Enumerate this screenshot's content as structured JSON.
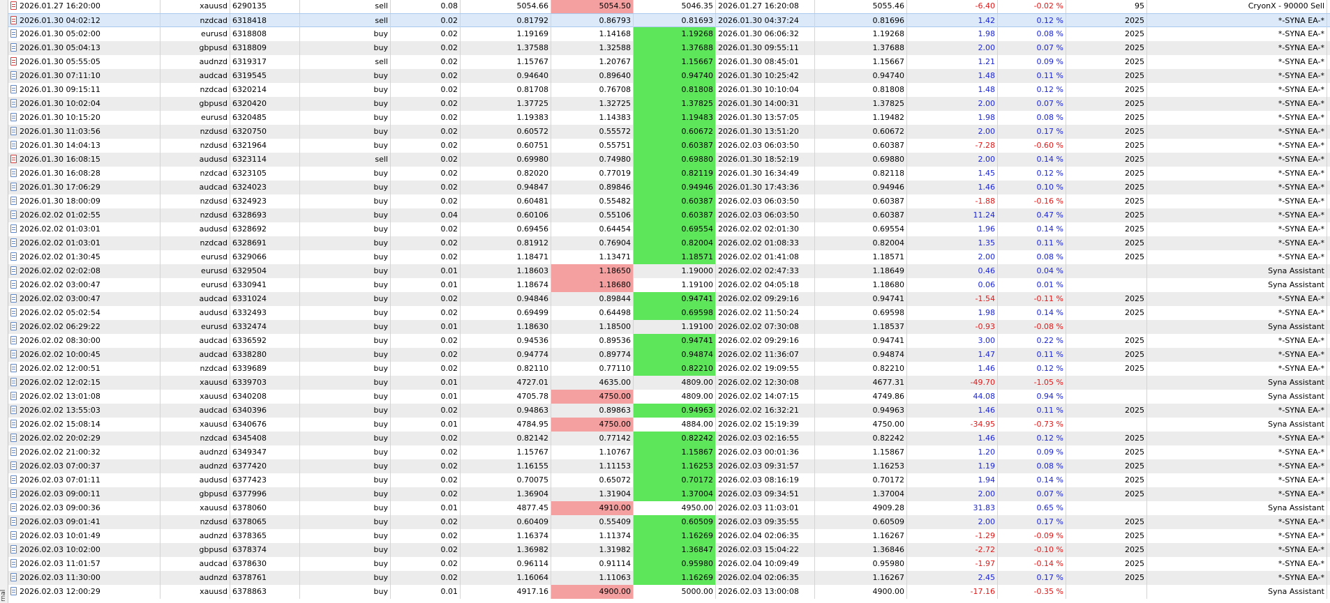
{
  "colors": {
    "sl_hit": "#f4a0a0",
    "tp_hit": "#5ee65a",
    "profit_positive": "#1a24d6",
    "profit_negative": "#e01818",
    "selected_row": "#dbe9f9"
  },
  "panel": {
    "side_label": "rnal"
  },
  "rows": [
    {
      "time": "2026.01.27 16:20:00",
      "symbol": "xauusd",
      "ticket": "6290135",
      "type": "sell",
      "volume": "0.08",
      "price": "5054.66",
      "sl": "5054.50",
      "tp": "5046.35",
      "close_time": "2026.01.27 16:20:08",
      "close_price": "5055.46",
      "profit": "-6.40",
      "change": "-0.02 %",
      "magic": "95",
      "comment": "CryonX - 90000 Sell",
      "sl_hit": true,
      "tp_hit": false
    },
    {
      "time": "2026.01.30 04:02:12",
      "symbol": "nzdcad",
      "ticket": "6318418",
      "type": "sell",
      "volume": "0.02",
      "price": "0.81792",
      "sl": "0.86793",
      "tp": "0.81693",
      "close_time": "2026.01.30 04:37:24",
      "close_price": "0.81696",
      "profit": "1.42",
      "change": "0.12 %",
      "magic": "2025",
      "comment": "*-SYNA EA-*",
      "sl_hit": false,
      "tp_hit": false,
      "selected": true
    },
    {
      "time": "2026.01.30 05:02:00",
      "symbol": "eurusd",
      "ticket": "6318808",
      "type": "buy",
      "volume": "0.02",
      "price": "1.19169",
      "sl": "1.14168",
      "tp": "1.19268",
      "close_time": "2026.01.30 06:06:32",
      "close_price": "1.19268",
      "profit": "1.98",
      "change": "0.08 %",
      "magic": "2025",
      "comment": "*-SYNA EA-*",
      "sl_hit": false,
      "tp_hit": true
    },
    {
      "time": "2026.01.30 05:04:13",
      "symbol": "gbpusd",
      "ticket": "6318809",
      "type": "buy",
      "volume": "0.02",
      "price": "1.37588",
      "sl": "1.32588",
      "tp": "1.37688",
      "close_time": "2026.01.30 09:55:11",
      "close_price": "1.37688",
      "profit": "2.00",
      "change": "0.07 %",
      "magic": "2025",
      "comment": "*-SYNA EA-*",
      "sl_hit": false,
      "tp_hit": true
    },
    {
      "time": "2026.01.30 05:55:05",
      "symbol": "audnzd",
      "ticket": "6319317",
      "type": "sell",
      "volume": "0.02",
      "price": "1.15767",
      "sl": "1.20767",
      "tp": "1.15667",
      "close_time": "2026.01.30 08:45:01",
      "close_price": "1.15667",
      "profit": "1.21",
      "change": "0.09 %",
      "magic": "2025",
      "comment": "*-SYNA EA-*",
      "sl_hit": false,
      "tp_hit": true
    },
    {
      "time": "2026.01.30 07:11:10",
      "symbol": "audcad",
      "ticket": "6319545",
      "type": "buy",
      "volume": "0.02",
      "price": "0.94640",
      "sl": "0.89640",
      "tp": "0.94740",
      "close_time": "2026.01.30 10:25:42",
      "close_price": "0.94740",
      "profit": "1.48",
      "change": "0.11 %",
      "magic": "2025",
      "comment": "*-SYNA EA-*",
      "sl_hit": false,
      "tp_hit": true
    },
    {
      "time": "2026.01.30 09:15:11",
      "symbol": "nzdcad",
      "ticket": "6320214",
      "type": "buy",
      "volume": "0.02",
      "price": "0.81708",
      "sl": "0.76708",
      "tp": "0.81808",
      "close_time": "2026.01.30 10:10:04",
      "close_price": "0.81808",
      "profit": "1.48",
      "change": "0.12 %",
      "magic": "2025",
      "comment": "*-SYNA EA-*",
      "sl_hit": false,
      "tp_hit": true
    },
    {
      "time": "2026.01.30 10:02:04",
      "symbol": "gbpusd",
      "ticket": "6320420",
      "type": "buy",
      "volume": "0.02",
      "price": "1.37725",
      "sl": "1.32725",
      "tp": "1.37825",
      "close_time": "2026.01.30 14:00:31",
      "close_price": "1.37825",
      "profit": "2.00",
      "change": "0.07 %",
      "magic": "2025",
      "comment": "*-SYNA EA-*",
      "sl_hit": false,
      "tp_hit": true
    },
    {
      "time": "2026.01.30 10:15:20",
      "symbol": "eurusd",
      "ticket": "6320485",
      "type": "buy",
      "volume": "0.02",
      "price": "1.19383",
      "sl": "1.14383",
      "tp": "1.19483",
      "close_time": "2026.01.30 13:57:05",
      "close_price": "1.19482",
      "profit": "1.98",
      "change": "0.08 %",
      "magic": "2025",
      "comment": "*-SYNA EA-*",
      "sl_hit": false,
      "tp_hit": true
    },
    {
      "time": "2026.01.30 11:03:56",
      "symbol": "nzdusd",
      "ticket": "6320750",
      "type": "buy",
      "volume": "0.02",
      "price": "0.60572",
      "sl": "0.55572",
      "tp": "0.60672",
      "close_time": "2026.01.30 13:51:20",
      "close_price": "0.60672",
      "profit": "2.00",
      "change": "0.17 %",
      "magic": "2025",
      "comment": "*-SYNA EA-*",
      "sl_hit": false,
      "tp_hit": true
    },
    {
      "time": "2026.01.30 14:04:13",
      "symbol": "nzdusd",
      "ticket": "6321964",
      "type": "buy",
      "volume": "0.02",
      "price": "0.60751",
      "sl": "0.55751",
      "tp": "0.60387",
      "close_time": "2026.02.03 06:03:50",
      "close_price": "0.60387",
      "profit": "-7.28",
      "change": "-0.60 %",
      "magic": "2025",
      "comment": "*-SYNA EA-*",
      "sl_hit": false,
      "tp_hit": true
    },
    {
      "time": "2026.01.30 16:08:15",
      "symbol": "audusd",
      "ticket": "6323114",
      "type": "sell",
      "volume": "0.02",
      "price": "0.69980",
      "sl": "0.74980",
      "tp": "0.69880",
      "close_time": "2026.01.30 18:52:19",
      "close_price": "0.69880",
      "profit": "2.00",
      "change": "0.14 %",
      "magic": "2025",
      "comment": "*-SYNA EA-*",
      "sl_hit": false,
      "tp_hit": true
    },
    {
      "time": "2026.01.30 16:08:28",
      "symbol": "nzdcad",
      "ticket": "6323105",
      "type": "buy",
      "volume": "0.02",
      "price": "0.82020",
      "sl": "0.77019",
      "tp": "0.82119",
      "close_time": "2026.01.30 16:34:49",
      "close_price": "0.82118",
      "profit": "1.45",
      "change": "0.12 %",
      "magic": "2025",
      "comment": "*-SYNA EA-*",
      "sl_hit": false,
      "tp_hit": true
    },
    {
      "time": "2026.01.30 17:06:29",
      "symbol": "audcad",
      "ticket": "6324023",
      "type": "buy",
      "volume": "0.02",
      "price": "0.94847",
      "sl": "0.89846",
      "tp": "0.94946",
      "close_time": "2026.01.30 17:43:36",
      "close_price": "0.94946",
      "profit": "1.46",
      "change": "0.10 %",
      "magic": "2025",
      "comment": "*-SYNA EA-*",
      "sl_hit": false,
      "tp_hit": true
    },
    {
      "time": "2026.01.30 18:00:09",
      "symbol": "nzdusd",
      "ticket": "6324923",
      "type": "buy",
      "volume": "0.02",
      "price": "0.60481",
      "sl": "0.55482",
      "tp": "0.60387",
      "close_time": "2026.02.03 06:03:50",
      "close_price": "0.60387",
      "profit": "-1.88",
      "change": "-0.16 %",
      "magic": "2025",
      "comment": "*-SYNA EA-*",
      "sl_hit": false,
      "tp_hit": true
    },
    {
      "time": "2026.02.02 01:02:55",
      "symbol": "nzdusd",
      "ticket": "6328693",
      "type": "buy",
      "volume": "0.04",
      "price": "0.60106",
      "sl": "0.55106",
      "tp": "0.60387",
      "close_time": "2026.02.03 06:03:50",
      "close_price": "0.60387",
      "profit": "11.24",
      "change": "0.47 %",
      "magic": "2025",
      "comment": "*-SYNA EA-*",
      "sl_hit": false,
      "tp_hit": true
    },
    {
      "time": "2026.02.02 01:03:01",
      "symbol": "audusd",
      "ticket": "6328692",
      "type": "buy",
      "volume": "0.02",
      "price": "0.69456",
      "sl": "0.64454",
      "tp": "0.69554",
      "close_time": "2026.02.02 02:01:30",
      "close_price": "0.69554",
      "profit": "1.96",
      "change": "0.14 %",
      "magic": "2025",
      "comment": "*-SYNA EA-*",
      "sl_hit": false,
      "tp_hit": true
    },
    {
      "time": "2026.02.02 01:03:01",
      "symbol": "nzdcad",
      "ticket": "6328691",
      "type": "buy",
      "volume": "0.02",
      "price": "0.81912",
      "sl": "0.76904",
      "tp": "0.82004",
      "close_time": "2026.02.02 01:08:33",
      "close_price": "0.82004",
      "profit": "1.35",
      "change": "0.11 %",
      "magic": "2025",
      "comment": "*-SYNA EA-*",
      "sl_hit": false,
      "tp_hit": true
    },
    {
      "time": "2026.02.02 01:30:45",
      "symbol": "eurusd",
      "ticket": "6329066",
      "type": "buy",
      "volume": "0.02",
      "price": "1.18471",
      "sl": "1.13471",
      "tp": "1.18571",
      "close_time": "2026.02.02 01:41:08",
      "close_price": "1.18571",
      "profit": "2.00",
      "change": "0.08 %",
      "magic": "2025",
      "comment": "*-SYNA EA-*",
      "sl_hit": false,
      "tp_hit": true
    },
    {
      "time": "2026.02.02 02:02:08",
      "symbol": "eurusd",
      "ticket": "6329504",
      "type": "buy",
      "volume": "0.01",
      "price": "1.18603",
      "sl": "1.18650",
      "tp": "1.19000",
      "close_time": "2026.02.02 02:47:33",
      "close_price": "1.18649",
      "profit": "0.46",
      "change": "0.04 %",
      "magic": "",
      "comment": "Syna Assistant",
      "sl_hit": true,
      "tp_hit": false
    },
    {
      "time": "2026.02.02 03:00:47",
      "symbol": "eurusd",
      "ticket": "6330941",
      "type": "buy",
      "volume": "0.01",
      "price": "1.18674",
      "sl": "1.18680",
      "tp": "1.19100",
      "close_time": "2026.02.02 04:05:18",
      "close_price": "1.18680",
      "profit": "0.06",
      "change": "0.01 %",
      "magic": "",
      "comment": "Syna Assistant",
      "sl_hit": true,
      "tp_hit": false
    },
    {
      "time": "2026.02.02 03:00:47",
      "symbol": "audcad",
      "ticket": "6331024",
      "type": "buy",
      "volume": "0.02",
      "price": "0.94846",
      "sl": "0.89844",
      "tp": "0.94741",
      "close_time": "2026.02.02 09:29:16",
      "close_price": "0.94741",
      "profit": "-1.54",
      "change": "-0.11 %",
      "magic": "2025",
      "comment": "*-SYNA EA-*",
      "sl_hit": false,
      "tp_hit": true
    },
    {
      "time": "2026.02.02 05:02:54",
      "symbol": "audusd",
      "ticket": "6332493",
      "type": "buy",
      "volume": "0.02",
      "price": "0.69499",
      "sl": "0.64498",
      "tp": "0.69598",
      "close_time": "2026.02.02 11:50:24",
      "close_price": "0.69598",
      "profit": "1.98",
      "change": "0.14 %",
      "magic": "2025",
      "comment": "*-SYNA EA-*",
      "sl_hit": false,
      "tp_hit": true
    },
    {
      "time": "2026.02.02 06:29:22",
      "symbol": "eurusd",
      "ticket": "6332474",
      "type": "buy",
      "volume": "0.01",
      "price": "1.18630",
      "sl": "1.18500",
      "tp": "1.19100",
      "close_time": "2026.02.02 07:30:08",
      "close_price": "1.18537",
      "profit": "-0.93",
      "change": "-0.08 %",
      "magic": "",
      "comment": "Syna Assistant",
      "sl_hit": false,
      "tp_hit": false
    },
    {
      "time": "2026.02.02 08:30:00",
      "symbol": "audcad",
      "ticket": "6336592",
      "type": "buy",
      "volume": "0.02",
      "price": "0.94536",
      "sl": "0.89536",
      "tp": "0.94741",
      "close_time": "2026.02.02 09:29:16",
      "close_price": "0.94741",
      "profit": "3.00",
      "change": "0.22 %",
      "magic": "2025",
      "comment": "*-SYNA EA-*",
      "sl_hit": false,
      "tp_hit": true
    },
    {
      "time": "2026.02.02 10:00:45",
      "symbol": "audcad",
      "ticket": "6338280",
      "type": "buy",
      "volume": "0.02",
      "price": "0.94774",
      "sl": "0.89774",
      "tp": "0.94874",
      "close_time": "2026.02.02 11:36:07",
      "close_price": "0.94874",
      "profit": "1.47",
      "change": "0.11 %",
      "magic": "2025",
      "comment": "*-SYNA EA-*",
      "sl_hit": false,
      "tp_hit": true
    },
    {
      "time": "2026.02.02 12:00:51",
      "symbol": "nzdcad",
      "ticket": "6339689",
      "type": "buy",
      "volume": "0.02",
      "price": "0.82110",
      "sl": "0.77110",
      "tp": "0.82210",
      "close_time": "2026.02.02 19:09:55",
      "close_price": "0.82210",
      "profit": "1.46",
      "change": "0.12 %",
      "magic": "2025",
      "comment": "*-SYNA EA-*",
      "sl_hit": false,
      "tp_hit": true
    },
    {
      "time": "2026.02.02 12:02:15",
      "symbol": "xauusd",
      "ticket": "6339703",
      "type": "buy",
      "volume": "0.01",
      "price": "4727.01",
      "sl": "4635.00",
      "tp": "4809.00",
      "close_time": "2026.02.02 12:30:08",
      "close_price": "4677.31",
      "profit": "-49.70",
      "change": "-1.05 %",
      "magic": "",
      "comment": "Syna Assistant",
      "sl_hit": false,
      "tp_hit": false
    },
    {
      "time": "2026.02.02 13:01:08",
      "symbol": "xauusd",
      "ticket": "6340208",
      "type": "buy",
      "volume": "0.01",
      "price": "4705.78",
      "sl": "4750.00",
      "tp": "4809.00",
      "close_time": "2026.02.02 14:07:15",
      "close_price": "4749.86",
      "profit": "44.08",
      "change": "0.94 %",
      "magic": "",
      "comment": "Syna Assistant",
      "sl_hit": true,
      "tp_hit": false
    },
    {
      "time": "2026.02.02 13:55:03",
      "symbol": "audcad",
      "ticket": "6340396",
      "type": "buy",
      "volume": "0.02",
      "price": "0.94863",
      "sl": "0.89863",
      "tp": "0.94963",
      "close_time": "2026.02.02 16:32:21",
      "close_price": "0.94963",
      "profit": "1.46",
      "change": "0.11 %",
      "magic": "2025",
      "comment": "*-SYNA EA-*",
      "sl_hit": false,
      "tp_hit": true
    },
    {
      "time": "2026.02.02 15:08:14",
      "symbol": "xauusd",
      "ticket": "6340676",
      "type": "buy",
      "volume": "0.01",
      "price": "4784.95",
      "sl": "4750.00",
      "tp": "4884.00",
      "close_time": "2026.02.02 15:19:39",
      "close_price": "4750.00",
      "profit": "-34.95",
      "change": "-0.73 %",
      "magic": "",
      "comment": "Syna Assistant",
      "sl_hit": true,
      "tp_hit": false
    },
    {
      "time": "2026.02.02 20:02:29",
      "symbol": "nzdcad",
      "ticket": "6345408",
      "type": "buy",
      "volume": "0.02",
      "price": "0.82142",
      "sl": "0.77142",
      "tp": "0.82242",
      "close_time": "2026.02.03 02:16:55",
      "close_price": "0.82242",
      "profit": "1.46",
      "change": "0.12 %",
      "magic": "2025",
      "comment": "*-SYNA EA-*",
      "sl_hit": false,
      "tp_hit": true
    },
    {
      "time": "2026.02.02 21:00:32",
      "symbol": "audnzd",
      "ticket": "6349347",
      "type": "buy",
      "volume": "0.02",
      "price": "1.15767",
      "sl": "1.10767",
      "tp": "1.15867",
      "close_time": "2026.02.03 00:01:36",
      "close_price": "1.15867",
      "profit": "1.20",
      "change": "0.09 %",
      "magic": "2025",
      "comment": "*-SYNA EA-*",
      "sl_hit": false,
      "tp_hit": true
    },
    {
      "time": "2026.02.03 07:00:37",
      "symbol": "audnzd",
      "ticket": "6377420",
      "type": "buy",
      "volume": "0.02",
      "price": "1.16155",
      "sl": "1.11153",
      "tp": "1.16253",
      "close_time": "2026.02.03 09:31:57",
      "close_price": "1.16253",
      "profit": "1.19",
      "change": "0.08 %",
      "magic": "2025",
      "comment": "*-SYNA EA-*",
      "sl_hit": false,
      "tp_hit": true
    },
    {
      "time": "2026.02.03 07:01:11",
      "symbol": "audusd",
      "ticket": "6377423",
      "type": "buy",
      "volume": "0.02",
      "price": "0.70075",
      "sl": "0.65072",
      "tp": "0.70172",
      "close_time": "2026.02.03 08:16:19",
      "close_price": "0.70172",
      "profit": "1.94",
      "change": "0.14 %",
      "magic": "2025",
      "comment": "*-SYNA EA-*",
      "sl_hit": false,
      "tp_hit": true
    },
    {
      "time": "2026.02.03 09:00:11",
      "symbol": "gbpusd",
      "ticket": "6377996",
      "type": "buy",
      "volume": "0.02",
      "price": "1.36904",
      "sl": "1.31904",
      "tp": "1.37004",
      "close_time": "2026.02.03 09:34:51",
      "close_price": "1.37004",
      "profit": "2.00",
      "change": "0.07 %",
      "magic": "2025",
      "comment": "*-SYNA EA-*",
      "sl_hit": false,
      "tp_hit": true
    },
    {
      "time": "2026.02.03 09:00:36",
      "symbol": "xauusd",
      "ticket": "6378060",
      "type": "buy",
      "volume": "0.01",
      "price": "4877.45",
      "sl": "4910.00",
      "tp": "4950.00",
      "close_time": "2026.02.03 11:03:01",
      "close_price": "4909.28",
      "profit": "31.83",
      "change": "0.65 %",
      "magic": "",
      "comment": "Syna Assistant",
      "sl_hit": true,
      "tp_hit": false
    },
    {
      "time": "2026.02.03 09:01:41",
      "symbol": "nzdusd",
      "ticket": "6378065",
      "type": "buy",
      "volume": "0.02",
      "price": "0.60409",
      "sl": "0.55409",
      "tp": "0.60509",
      "close_time": "2026.02.03 09:35:55",
      "close_price": "0.60509",
      "profit": "2.00",
      "change": "0.17 %",
      "magic": "2025",
      "comment": "*-SYNA EA-*",
      "sl_hit": false,
      "tp_hit": true
    },
    {
      "time": "2026.02.03 10:01:49",
      "symbol": "audnzd",
      "ticket": "6378365",
      "type": "buy",
      "volume": "0.02",
      "price": "1.16374",
      "sl": "1.11374",
      "tp": "1.16269",
      "close_time": "2026.02.04 02:06:35",
      "close_price": "1.16267",
      "profit": "-1.29",
      "change": "-0.09 %",
      "magic": "2025",
      "comment": "*-SYNA EA-*",
      "sl_hit": false,
      "tp_hit": true
    },
    {
      "time": "2026.02.03 10:02:00",
      "symbol": "gbpusd",
      "ticket": "6378374",
      "type": "buy",
      "volume": "0.02",
      "price": "1.36982",
      "sl": "1.31982",
      "tp": "1.36847",
      "close_time": "2026.02.03 15:04:22",
      "close_price": "1.36846",
      "profit": "-2.72",
      "change": "-0.10 %",
      "magic": "2025",
      "comment": "*-SYNA EA-*",
      "sl_hit": false,
      "tp_hit": true
    },
    {
      "time": "2026.02.03 11:01:57",
      "symbol": "audcad",
      "ticket": "6378630",
      "type": "buy",
      "volume": "0.02",
      "price": "0.96114",
      "sl": "0.91114",
      "tp": "0.95980",
      "close_time": "2026.02.04 10:09:49",
      "close_price": "0.95980",
      "profit": "-1.97",
      "change": "-0.14 %",
      "magic": "2025",
      "comment": "*-SYNA EA-*",
      "sl_hit": false,
      "tp_hit": true
    },
    {
      "time": "2026.02.03 11:30:00",
      "symbol": "audnzd",
      "ticket": "6378761",
      "type": "buy",
      "volume": "0.02",
      "price": "1.16064",
      "sl": "1.11063",
      "tp": "1.16269",
      "close_time": "2026.02.04 02:06:35",
      "close_price": "1.16267",
      "profit": "2.45",
      "change": "0.17 %",
      "magic": "2025",
      "comment": "*-SYNA EA-*",
      "sl_hit": false,
      "tp_hit": true
    },
    {
      "time": "2026.02.03 12:00:29",
      "symbol": "xauusd",
      "ticket": "6378863",
      "type": "buy",
      "volume": "0.01",
      "price": "4917.16",
      "sl": "4900.00",
      "tp": "5000.00",
      "close_time": "2026.02.03 13:00:08",
      "close_price": "4900.00",
      "profit": "-17.16",
      "change": "-0.35 %",
      "magic": "",
      "comment": "Syna Assistant",
      "sl_hit": true,
      "tp_hit": false
    }
  ]
}
